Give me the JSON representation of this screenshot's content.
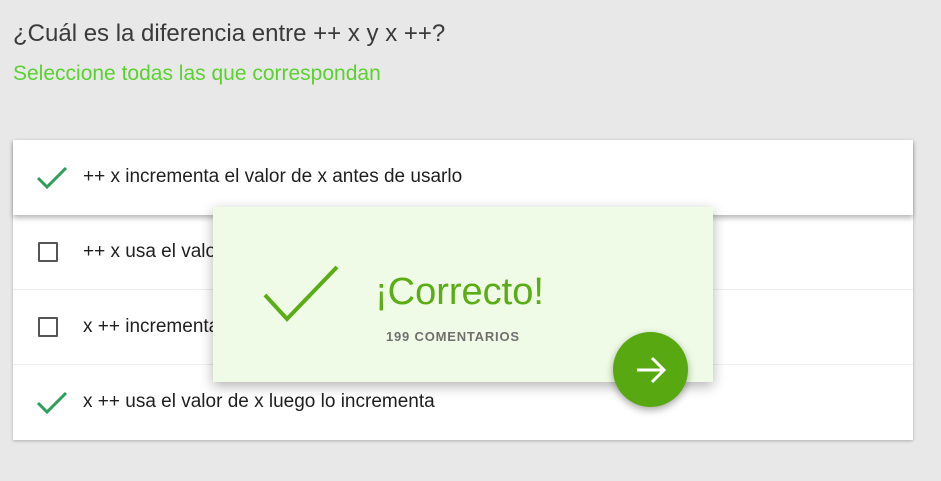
{
  "colors": {
    "accent_green": "#5bd130",
    "check_green": "#2e9e5b",
    "popup_bg": "#effbe6",
    "popup_green": "#5aad14",
    "button_green": "#58a811"
  },
  "question": {
    "title": "¿Cuál es la diferencia entre ++ x y x ++?",
    "subtitle": "Seleccione todas las que correspondan"
  },
  "options": [
    {
      "label": "++ x incrementa el valor de x antes de usarlo",
      "state": "correct",
      "icon": "check-icon"
    },
    {
      "label": "++ x usa el valor de x luego lo incrementa",
      "state": "unchecked",
      "icon": "checkbox-icon"
    },
    {
      "label": "x ++ incrementa el valor de x antes de usarlo",
      "state": "unchecked",
      "icon": "checkbox-icon"
    },
    {
      "label": "x ++ usa el valor de x luego lo incrementa",
      "state": "correct",
      "icon": "check-icon"
    }
  ],
  "feedback": {
    "title": "¡Correcto!",
    "comments": "199 COMENTARIOS",
    "icon": "check-icon",
    "next_icon": "arrow-right-icon"
  }
}
